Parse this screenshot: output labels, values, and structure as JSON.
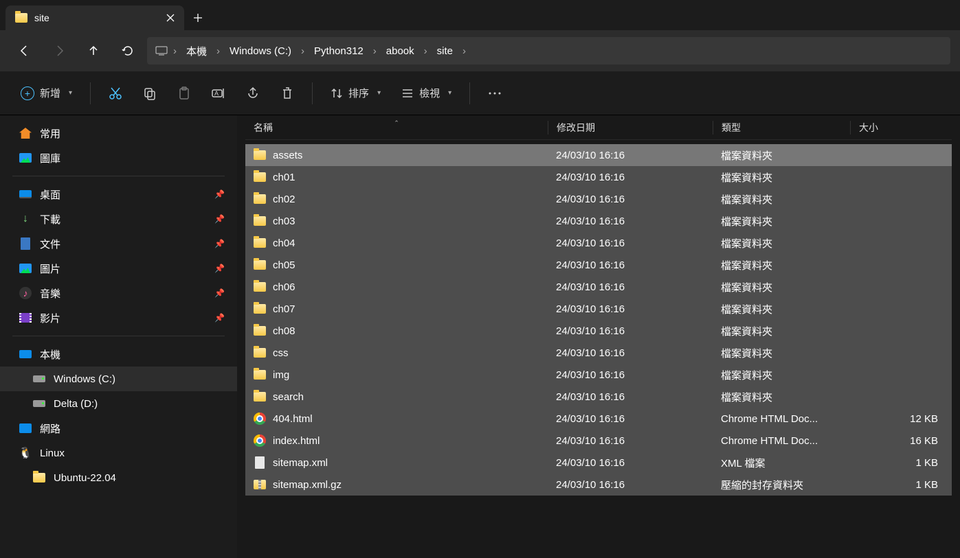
{
  "tab": {
    "title": "site"
  },
  "toolbar": {
    "new_label": "新增",
    "sort_label": "排序",
    "view_label": "檢視"
  },
  "breadcrumb": [
    {
      "label": "本機"
    },
    {
      "label": "Windows (C:)"
    },
    {
      "label": "Python312"
    },
    {
      "label": "abook"
    },
    {
      "label": "site"
    }
  ],
  "columns": {
    "name": "名稱",
    "date": "修改日期",
    "type": "類型",
    "size": "大小"
  },
  "sidebar": {
    "quick": [
      {
        "label": "常用",
        "icon": "home"
      },
      {
        "label": "圖庫",
        "icon": "pic"
      }
    ],
    "pinned": [
      {
        "label": "桌面",
        "icon": "desk"
      },
      {
        "label": "下載",
        "icon": "dl"
      },
      {
        "label": "文件",
        "icon": "doc"
      },
      {
        "label": "圖片",
        "icon": "pic"
      },
      {
        "label": "音樂",
        "icon": "music"
      },
      {
        "label": "影片",
        "icon": "video"
      }
    ],
    "drives_header": {
      "label": "本機",
      "icon": "pc"
    },
    "drives": [
      {
        "label": "Windows (C:)",
        "icon": "drive",
        "selected": true
      },
      {
        "label": "Delta (D:)",
        "icon": "drive"
      }
    ],
    "other": [
      {
        "label": "網路",
        "icon": "net"
      },
      {
        "label": "Linux",
        "icon": "linux"
      }
    ],
    "linux_children": [
      {
        "label": "Ubuntu-22.04",
        "icon": "folder"
      }
    ]
  },
  "files": [
    {
      "name": "assets",
      "date": "24/03/10 16:16",
      "type": "檔案資料夾",
      "size": "",
      "icon": "folder",
      "hl": true
    },
    {
      "name": "ch01",
      "date": "24/03/10 16:16",
      "type": "檔案資料夾",
      "size": "",
      "icon": "folder"
    },
    {
      "name": "ch02",
      "date": "24/03/10 16:16",
      "type": "檔案資料夾",
      "size": "",
      "icon": "folder"
    },
    {
      "name": "ch03",
      "date": "24/03/10 16:16",
      "type": "檔案資料夾",
      "size": "",
      "icon": "folder"
    },
    {
      "name": "ch04",
      "date": "24/03/10 16:16",
      "type": "檔案資料夾",
      "size": "",
      "icon": "folder"
    },
    {
      "name": "ch05",
      "date": "24/03/10 16:16",
      "type": "檔案資料夾",
      "size": "",
      "icon": "folder"
    },
    {
      "name": "ch06",
      "date": "24/03/10 16:16",
      "type": "檔案資料夾",
      "size": "",
      "icon": "folder"
    },
    {
      "name": "ch07",
      "date": "24/03/10 16:16",
      "type": "檔案資料夾",
      "size": "",
      "icon": "folder"
    },
    {
      "name": "ch08",
      "date": "24/03/10 16:16",
      "type": "檔案資料夾",
      "size": "",
      "icon": "folder"
    },
    {
      "name": "css",
      "date": "24/03/10 16:16",
      "type": "檔案資料夾",
      "size": "",
      "icon": "folder"
    },
    {
      "name": "img",
      "date": "24/03/10 16:16",
      "type": "檔案資料夾",
      "size": "",
      "icon": "folder"
    },
    {
      "name": "search",
      "date": "24/03/10 16:16",
      "type": "檔案資料夾",
      "size": "",
      "icon": "folder"
    },
    {
      "name": "404.html",
      "date": "24/03/10 16:16",
      "type": "Chrome HTML Doc...",
      "size": "12 KB",
      "icon": "chrome"
    },
    {
      "name": "index.html",
      "date": "24/03/10 16:16",
      "type": "Chrome HTML Doc...",
      "size": "16 KB",
      "icon": "chrome"
    },
    {
      "name": "sitemap.xml",
      "date": "24/03/10 16:16",
      "type": "XML 檔案",
      "size": "1 KB",
      "icon": "file"
    },
    {
      "name": "sitemap.xml.gz",
      "date": "24/03/10 16:16",
      "type": "壓縮的封存資料夾",
      "size": "1 KB",
      "icon": "zip"
    }
  ]
}
